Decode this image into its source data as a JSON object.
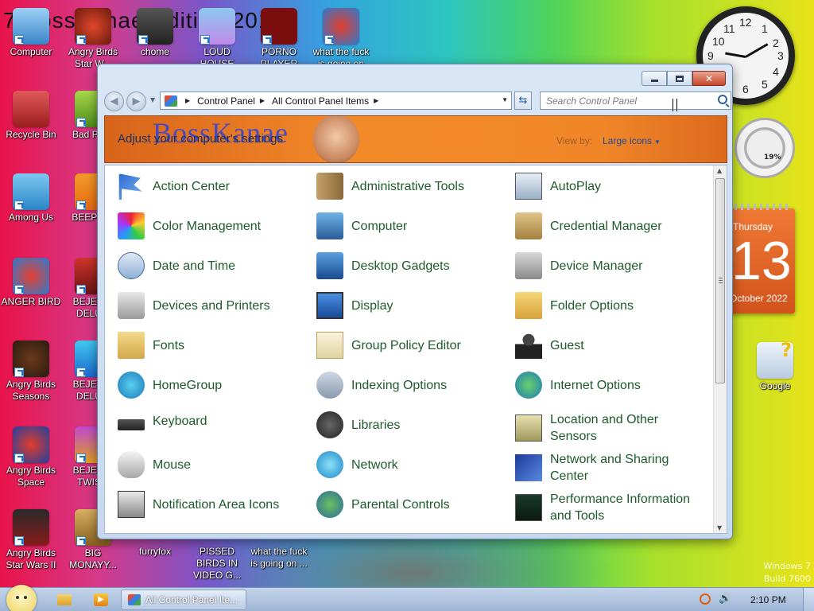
{
  "desktop": {
    "title_text": "7 BossKanae Edition 2012",
    "icons": [
      {
        "label": "Computer"
      },
      {
        "label": "Angry Birds Star W..."
      },
      {
        "label": "chome"
      },
      {
        "label": "LOUD HOUSE"
      },
      {
        "label": "PORNO PLAYER"
      },
      {
        "label": "what the fuck is going on"
      },
      {
        "label": "Recycle Bin"
      },
      {
        "label": "Bad Pig..."
      },
      {
        "label": "Among Us"
      },
      {
        "label": "BEEP B..."
      },
      {
        "label": "ANGER BIRD"
      },
      {
        "label": "BEJEW... DELU..."
      },
      {
        "label": "Angry Birds Seasons"
      },
      {
        "label": "BEJEW... DELU..."
      },
      {
        "label": "Angry Birds Space"
      },
      {
        "label": "BEJEW... TWIS..."
      },
      {
        "label": "Angry Birds Star Wars II"
      },
      {
        "label": "BIG MONAYY..."
      },
      {
        "label": "furryfox"
      },
      {
        "label": "PISSED BIRDS IN VIDEO G..."
      },
      {
        "label": "what the fuck is going on ..."
      },
      {
        "label": "Google"
      }
    ],
    "calendar": {
      "weekday": "Thursday",
      "day": "13",
      "month_year": "October 2022"
    },
    "meter_percent": "19%",
    "clock_numbers": [
      "12",
      "1",
      "2",
      "3",
      "4",
      "5",
      "6",
      "7",
      "8",
      "9",
      "10",
      "11"
    ],
    "watermark": [
      "Windows 7",
      "Build 7600"
    ]
  },
  "window": {
    "breadcrumb": [
      "Control Panel",
      "All Control Panel Items"
    ],
    "search_placeholder": "Search Control Panel",
    "brand_text": "BossKanae",
    "header_title": "Adjust your computer's settings",
    "view_by_label": "View by:",
    "view_by_value": "Large icons",
    "items": [
      {
        "label": "Action Center",
        "icon": "flag-icon"
      },
      {
        "label": "Administrative Tools",
        "icon": "tools-icon"
      },
      {
        "label": "AutoPlay",
        "icon": "autoplay-icon"
      },
      {
        "label": "Color Management",
        "icon": "color-management-icon"
      },
      {
        "label": "Computer",
        "icon": "computer-icon"
      },
      {
        "label": "Credential Manager",
        "icon": "credential-icon"
      },
      {
        "label": "Date and Time",
        "icon": "clock-calendar-icon"
      },
      {
        "label": "Desktop Gadgets",
        "icon": "gadgets-icon"
      },
      {
        "label": "Device Manager",
        "icon": "device-manager-icon"
      },
      {
        "label": "Devices and Printers",
        "icon": "printer-icon"
      },
      {
        "label": "Display",
        "icon": "monitor-icon"
      },
      {
        "label": "Folder Options",
        "icon": "folder-options-icon"
      },
      {
        "label": "Fonts",
        "icon": "fonts-icon"
      },
      {
        "label": "Group Policy Editor",
        "icon": "policy-icon"
      },
      {
        "label": "Guest",
        "icon": "guest-user-icon"
      },
      {
        "label": "HomeGroup",
        "icon": "homegroup-icon"
      },
      {
        "label": "Indexing Options",
        "icon": "indexing-icon"
      },
      {
        "label": "Internet Options",
        "icon": "internet-options-icon"
      },
      {
        "label": "Keyboard",
        "icon": "keyboard-icon"
      },
      {
        "label": "Libraries",
        "icon": "libraries-icon"
      },
      {
        "label": "Location and Other Sensors",
        "icon": "sensors-icon"
      },
      {
        "label": "Mouse",
        "icon": "mouse-icon"
      },
      {
        "label": "Network",
        "icon": "network-globe-icon"
      },
      {
        "label": "Network and Sharing Center",
        "icon": "network-sharing-icon"
      },
      {
        "label": "Notification Area Icons",
        "icon": "notification-icon"
      },
      {
        "label": "Parental Controls",
        "icon": "parental-controls-icon"
      },
      {
        "label": "Performance Information and Tools",
        "icon": "performance-icon"
      }
    ]
  },
  "taskbar": {
    "task_label": "All Control Panel Ite...",
    "time": "2:10 PM"
  },
  "colors": {
    "link_green": "#1d5a2c",
    "header_orange": "#f08628"
  }
}
